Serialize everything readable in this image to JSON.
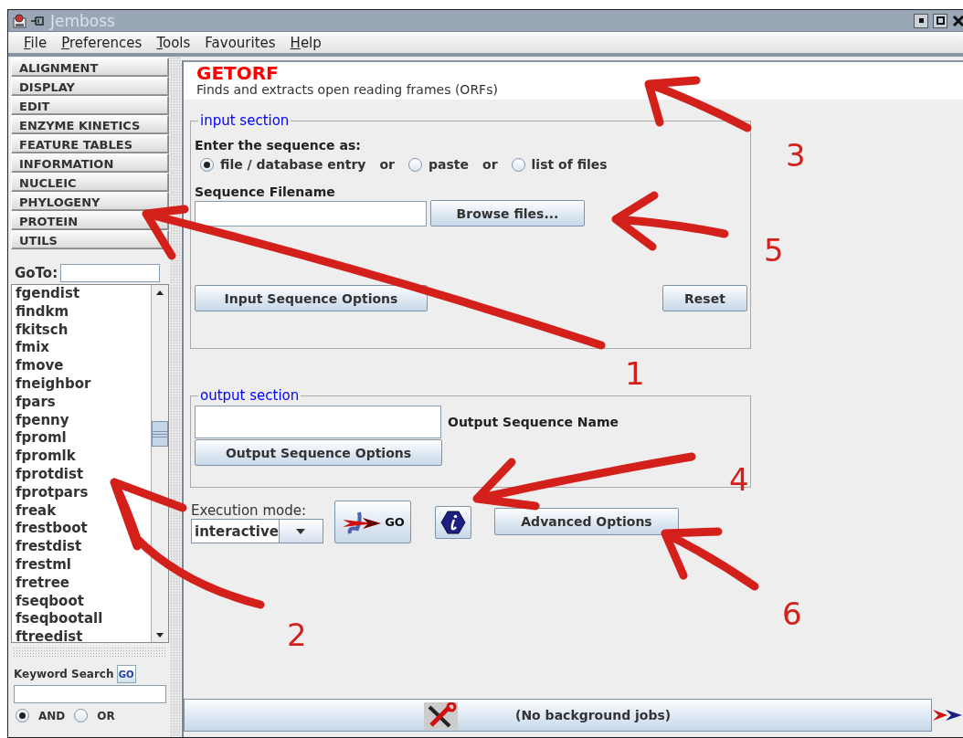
{
  "window": {
    "title": "Jemboss"
  },
  "menu": [
    {
      "label": "File",
      "mnemonic": true
    },
    {
      "label": "Preferences",
      "mnemonic": true
    },
    {
      "label": "Tools",
      "mnemonic": true
    },
    {
      "label": "Favourites",
      "mnemonic": false
    },
    {
      "label": "Help",
      "mnemonic": true
    }
  ],
  "categories": [
    "ALIGNMENT",
    "DISPLAY",
    "EDIT",
    "ENZYME KINETICS",
    "FEATURE TABLES",
    "INFORMATION",
    "NUCLEIC",
    "PHYLOGENY",
    "PROTEIN",
    "UTILS"
  ],
  "goto": {
    "label": "GoTo:"
  },
  "programs": [
    "fgendist",
    "findkm",
    "fkitsch",
    "fmix",
    "fmove",
    "fneighbor",
    "fpars",
    "fpenny",
    "fproml",
    "fpromlk",
    "fprotdist",
    "fprotpars",
    "freak",
    "frestboot",
    "frestdist",
    "frestml",
    "fretree",
    "fseqboot",
    "fseqbootall",
    "ftreedist"
  ],
  "keyword_search": {
    "label": "Keyword Search",
    "button": "GO",
    "options": [
      {
        "label": "AND",
        "selected": true
      },
      {
        "label": "OR",
        "selected": false
      }
    ]
  },
  "program": {
    "name": "GETORF",
    "description": "Finds and extracts open reading frames (ORFs)"
  },
  "input_section": {
    "legend": "input section",
    "prompt": "Enter the sequence as:",
    "sources": [
      {
        "label": "file / database entry",
        "selected": true,
        "joiner": "or"
      },
      {
        "label": "paste",
        "selected": false,
        "joiner": "or"
      },
      {
        "label": "list of files",
        "selected": false
      }
    ],
    "filename_label": "Sequence Filename",
    "browse_button": "Browse files...",
    "options_button": "Input Sequence Options",
    "reset_button": "Reset"
  },
  "output_section": {
    "legend": "output section",
    "name_label": "Output Sequence Name",
    "options_button": "Output Sequence Options"
  },
  "execution": {
    "label": "Execution mode:",
    "mode": "interactive",
    "go_button": "GO",
    "advanced_button": "Advanced Options"
  },
  "status_bar": {
    "text": "(No background jobs)"
  },
  "annotations": [
    {
      "label": "1"
    },
    {
      "label": "2"
    },
    {
      "label": "3"
    },
    {
      "label": "4"
    },
    {
      "label": "5"
    },
    {
      "label": "6"
    }
  ]
}
